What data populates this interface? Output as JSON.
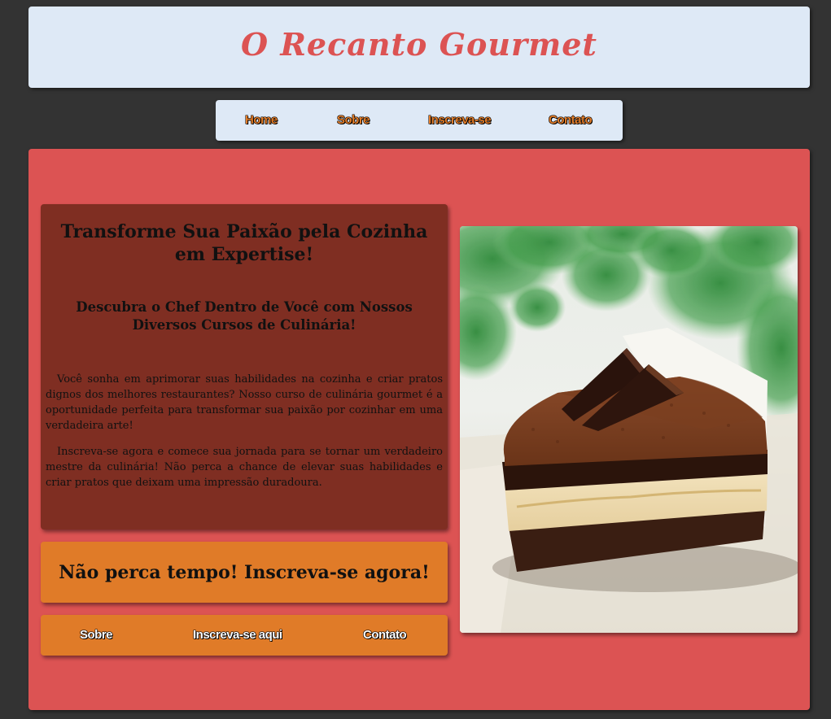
{
  "header": {
    "title": "O Recanto Gourmet"
  },
  "top_nav": {
    "items": [
      {
        "label": "Home"
      },
      {
        "label": "Sobre"
      },
      {
        "label": "Inscreva-se"
      },
      {
        "label": "Contato"
      }
    ]
  },
  "main": {
    "heading": "Transforme Sua Paixão pela Cozinha em Expertise!",
    "subheading": "Descubra o Chef Dentro de Você com Nossos Diversos Cursos de Culinária!",
    "paragraphs": [
      "Você sonha em aprimorar suas habilidades na cozinha e criar pratos dignos dos melhores restaurantes? Nosso curso de culinária gourmet é a oportunidade perfeita para transformar sua paixão por cozinhar em uma verdadeira arte!",
      "Inscreva-se agora e comece sua jornada para se tornar um verdadeiro mestre da culinária! Não perca a chance de elevar suas habilidades e criar pratos que deixam uma impressão duradoura."
    ],
    "cta": "Não perca tempo! Inscreva-se agora!"
  },
  "bottom_nav": {
    "items": [
      {
        "label": "Sobre"
      },
      {
        "label": "Inscreva-se aqui"
      },
      {
        "label": "Contato"
      }
    ]
  },
  "photo": {
    "subject": "chocolate-mousse-cake-slice"
  },
  "colors": {
    "background": "#333333",
    "header_bg": "#dee9f6",
    "title": "#dc5353",
    "main_bg": "#dc5353",
    "textbox_bg": "#7f2e22",
    "accent_orange": "#e07b28"
  }
}
